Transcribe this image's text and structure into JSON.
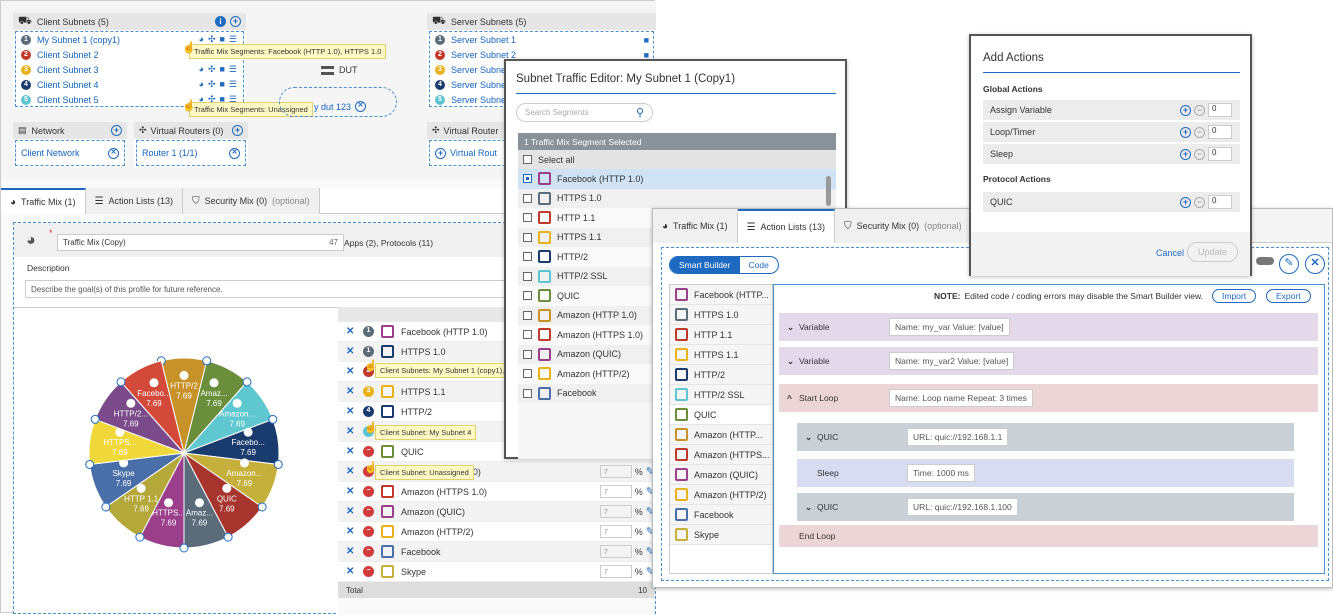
{
  "topology": {
    "client_subnets": {
      "title": "Client Subnets (5)",
      "items": [
        {
          "n": "1",
          "label": "My Subnet 1 (copy1)",
          "color": "#5b6b7a"
        },
        {
          "n": "2",
          "label": "Client Subnet 2",
          "color": "#c0392b"
        },
        {
          "n": "3",
          "label": "Client Subnet 3",
          "color": "#e8b21c"
        },
        {
          "n": "4",
          "label": "Client Subnet 4",
          "color": "#1a3b6e"
        },
        {
          "n": "5",
          "label": "Client Subnet 5",
          "color": "#5fc4d1"
        }
      ]
    },
    "tooltip1": "Traffic Mix Segments: Facebook (HTTP 1.0), HTTPS 1.0",
    "tooltip2": "Traffic Mix Segments: Unassigned",
    "dut_label": "DUT",
    "dut_link": "y dut 123",
    "server_subnets": {
      "title": "Server Subnets (5)",
      "items": [
        {
          "n": "1",
          "label": "Server Subnet 1",
          "color": "#5b6b7a"
        },
        {
          "n": "2",
          "label": "Server Subnet 2",
          "color": "#c0392b"
        },
        {
          "n": "3",
          "label": "Server Subne",
          "color": "#e8b21c"
        },
        {
          "n": "4",
          "label": "Server Subne",
          "color": "#1a3b6e"
        },
        {
          "n": "5",
          "label": "Server Subne",
          "color": "#5fc4d1"
        }
      ]
    },
    "network": {
      "title": "Network",
      "item": "Client Network"
    },
    "vrouters": {
      "title": "Virtual Routers (0)",
      "item": "Router 1 (1/1)"
    },
    "vrouters2": {
      "title": "Virtual Router",
      "item": "Virtual Rout"
    }
  },
  "tabs1": {
    "traffic_mix": "Traffic Mix (1)",
    "action_lists": "Action Lists (13)",
    "security_mix": "Security Mix (0)",
    "optional": "(optional)"
  },
  "mix": {
    "name": "Traffic Mix (Copy)",
    "count": "47",
    "apps_label": "Apps (2), Protocols (11)",
    "desc_label": "Description",
    "desc_placeholder": "Describe the goal(s) of this profile for future reference.",
    "total_label": "Total",
    "total_val": "10"
  },
  "chart_data": {
    "type": "pie",
    "slices": [
      {
        "label": "HTTP/2",
        "value": 7.69,
        "color": "#c8922a"
      },
      {
        "label": "Amaz...",
        "value": 7.69,
        "color": "#6a8e3c"
      },
      {
        "label": "Amazon...",
        "value": 7.69,
        "color": "#5ec7cf"
      },
      {
        "label": "Facebo...",
        "value": 7.69,
        "color": "#1a3b6e"
      },
      {
        "label": "Amazon...",
        "value": 7.69,
        "color": "#c5b03c"
      },
      {
        "label": "QUIC",
        "value": 7.69,
        "color": "#a8342e"
      },
      {
        "label": "Amaz...",
        "value": 7.69,
        "color": "#5b6b7a"
      },
      {
        "label": "HTTPS...",
        "value": 7.69,
        "color": "#9b3f8a"
      },
      {
        "label": "HTTP 1.1",
        "value": 7.69,
        "color": "#b4a83a"
      },
      {
        "label": "Skype",
        "value": 7.69,
        "color": "#4a6fa8"
      },
      {
        "label": "HTTPS...",
        "value": 7.69,
        "color": "#f0d83a"
      },
      {
        "label": "HTTP/2...",
        "value": 7.69,
        "color": "#7a4a8a"
      },
      {
        "label": "Facebo...",
        "value": 7.69,
        "color": "#d44a3a"
      }
    ]
  },
  "segments": [
    {
      "label": "Facebook (HTTP 1.0)",
      "dot": "#5b6b7a",
      "dn": "1",
      "icon": "#9b3f8a"
    },
    {
      "label": "HTTPS 1.0",
      "dot": "#5b6b7a",
      "dn": "1",
      "icon": "#1a3b6e"
    },
    {
      "label": "HTTP 1.1",
      "dot": "#c0392b",
      "dn": "2",
      "icon": "#c0392b"
    },
    {
      "label": "HTTPS 1.1",
      "dot": "#e8b21c",
      "dn": "3",
      "icon": "#e8b21c"
    },
    {
      "label": "HTTP/2",
      "dot": "#1a3b6e",
      "dn": "4",
      "icon": "#1a3b6e"
    },
    {
      "label": "HTTP/2 SSL",
      "dot": "#5fc4d1",
      "dn": "5",
      "icon": "#5fc4d1"
    },
    {
      "label": "QUIC",
      "dot": "#d13b3b",
      "dn": "−",
      "icon": "#6a8e3c"
    },
    {
      "label": "Amazon (HTTP 1.0)",
      "dot": "#d13b3b",
      "dn": "−",
      "icon": "#c8922a"
    },
    {
      "label": "Amazon (HTTPS 1.0)",
      "dot": "#d13b3b",
      "dn": "−",
      "icon": "#c0392b"
    },
    {
      "label": "Amazon (QUIC)",
      "dot": "#d13b3b",
      "dn": "−",
      "icon": "#9b3f8a"
    },
    {
      "label": "Amazon (HTTP/2)",
      "dot": "#d13b3b",
      "dn": "−",
      "icon": "#e8b21c"
    },
    {
      "label": "Facebook",
      "dot": "#d13b3b",
      "dn": "−",
      "icon": "#4a6fa8"
    },
    {
      "label": "Skype",
      "dot": "#d13b3b",
      "dn": "−",
      "icon": "#c5b03c"
    }
  ],
  "seg_pct": "7",
  "seg_unit": "%",
  "tip_a": "Client Subnets: My Subnet 1 (copy1),",
  "tip_b": "Client Subnet: My Subnet 4",
  "tip_c": "Client Subnet: Unassigned",
  "editor": {
    "title": "Subnet Traffic Editor: My Subnet 1 (Copy1)",
    "search": "Search Segments",
    "selected": "1 Traffic Mix Segment Selected",
    "select_all": "Select all",
    "items": [
      {
        "label": "Facebook (HTTP 1.0)",
        "color": "#9b3f8a",
        "checked": true
      },
      {
        "label": "HTTPS 1.0",
        "color": "#5b6b7a"
      },
      {
        "label": "HTTP 1.1",
        "color": "#c0392b"
      },
      {
        "label": "HTTPS 1.1",
        "color": "#e8b21c"
      },
      {
        "label": "HTTP/2",
        "color": "#1a3b6e"
      },
      {
        "label": "HTTP/2 SSL",
        "color": "#5fc4d1"
      },
      {
        "label": "QUIC",
        "color": "#6a8e3c"
      },
      {
        "label": "Amazon (HTTP 1.0)",
        "color": "#c8922a"
      },
      {
        "label": "Amazon (HTTPS 1.0)",
        "color": "#c0392b"
      },
      {
        "label": "Amazon (QUIC)",
        "color": "#9b3f8a"
      },
      {
        "label": "Amazon (HTTP/2)",
        "color": "#e8b21c"
      },
      {
        "label": "Facebook",
        "color": "#4a6fa8"
      }
    ]
  },
  "tabs2": {
    "traffic_mix": "Traffic Mix (1)",
    "action_lists": "Action Lists (13)",
    "security_mix": "Security Mix (0)",
    "optional": "(optional)"
  },
  "builder": {
    "smart": "Smart Builder",
    "code": "Code",
    "note_bold": "NOTE:",
    "note": "Edited code / coding errors may disable the Smart Builder view.",
    "import": "Import",
    "export": "Export",
    "list": [
      {
        "label": "Facebook (HTTP...",
        "color": "#9b3f8a"
      },
      {
        "label": "HTTPS 1.0",
        "color": "#5b6b7a"
      },
      {
        "label": "HTTP 1.1",
        "color": "#c0392b"
      },
      {
        "label": "HTTPS 1.1",
        "color": "#e8b21c"
      },
      {
        "label": "HTTP/2",
        "color": "#1a3b6e"
      },
      {
        "label": "HTTP/2 SSL",
        "color": "#5fc4d1"
      },
      {
        "label": "QUIC",
        "color": "#6a8e3c"
      },
      {
        "label": "Amazon (HTTP...",
        "color": "#c8922a"
      },
      {
        "label": "Amazon (HTTPS...",
        "color": "#c0392b"
      },
      {
        "label": "Amazon (QUIC)",
        "color": "#9b3f8a"
      },
      {
        "label": "Amazon (HTTP/2)",
        "color": "#e8b21c"
      },
      {
        "label": "Facebook",
        "color": "#4a6fa8"
      },
      {
        "label": "Skype",
        "color": "#c5b03c"
      }
    ],
    "actions": [
      {
        "name": "Variable",
        "detail": "Name: my_var   Value: [value]",
        "bg": "#e3d9ea",
        "chev": "⌄"
      },
      {
        "name": "Variable",
        "detail": "Name: my_var2   Value: [value]",
        "bg": "#e3d9ea",
        "chev": "⌄"
      },
      {
        "name": "Start Loop",
        "detail": "Name: Loop name   Repeat: 3 times",
        "bg": "#ecd5d6",
        "chev": "^"
      },
      {
        "name": "QUIC",
        "detail": "URL: quic://192.168.1.1",
        "bg": "#c9d1d6",
        "chev": "⌄"
      },
      {
        "name": "Sleep",
        "detail": "Time: 1000 ms",
        "bg": "#d7dcf1",
        "chev": ""
      },
      {
        "name": "QUIC",
        "detail": "URL: quic://192.168.1.100",
        "bg": "#c9d1d6",
        "chev": "⌄"
      },
      {
        "name": "End Loop",
        "detail": "",
        "bg": "#ecd5d6",
        "chev": ""
      }
    ]
  },
  "add_actions": {
    "title": "Add Actions",
    "global": "Global Actions",
    "g_items": [
      "Assign Variable",
      "Loop/Timer",
      "Sleep"
    ],
    "protocol": "Protocol Actions",
    "p_items": [
      "QUIC"
    ],
    "count": "0",
    "cancel": "Cancel",
    "update": "Update"
  }
}
